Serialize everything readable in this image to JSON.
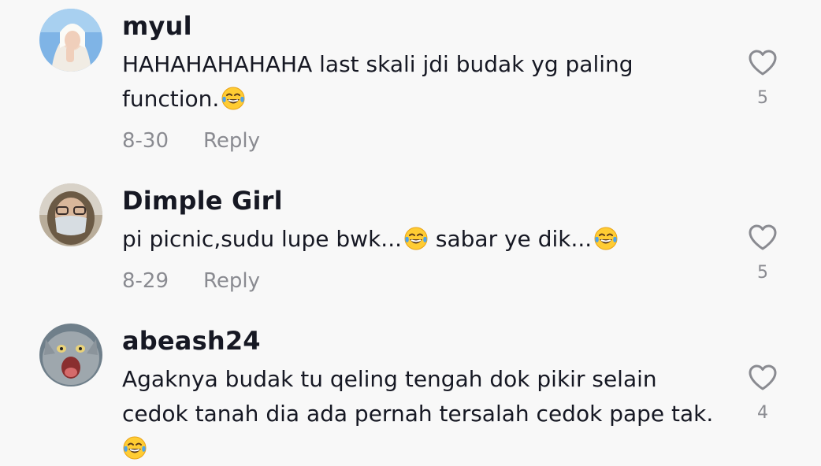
{
  "comments": [
    {
      "username": "myul",
      "text": "HAHAHAHAHAHA last skali jdi budak yg paling function.",
      "date": "8-30",
      "reply_label": "Reply",
      "likes": "5",
      "emoji": "face-with-tears-of-joy"
    },
    {
      "username": "Dimple Girl",
      "text_part1": "pi picnic,sudu lupe bwk...",
      "text_part2": " sabar ye dik...",
      "date": "8-29",
      "reply_label": "Reply",
      "likes": "5",
      "emoji": "face-with-tears-of-joy"
    },
    {
      "username": "abeash24",
      "text": "Agaknya budak tu qeling tengah dok pikir selain cedok tanah dia ada pernah tersalah cedok pape tak.",
      "likes": "4",
      "emoji": "face-with-tears-of-joy"
    }
  ],
  "icons": {
    "like": "heart-outline-icon",
    "emoji": "face-with-tears-of-joy"
  },
  "colors": {
    "background": "#f8f8f8",
    "primary_text": "#161823",
    "secondary_text": "#8a8b91"
  }
}
